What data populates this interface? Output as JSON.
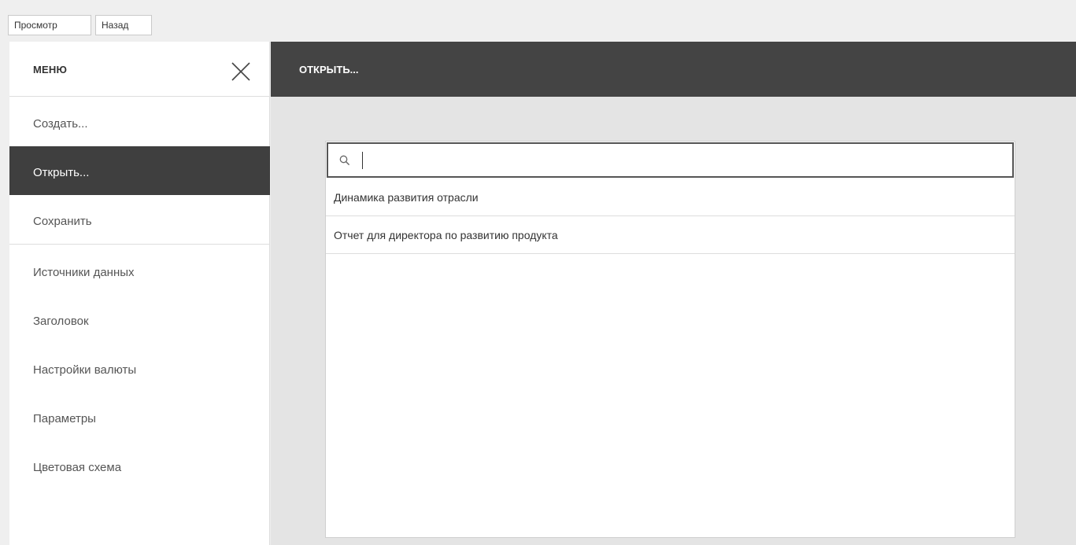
{
  "toolbar": {
    "preview_label": "Просмотр",
    "back_label": "Назад"
  },
  "sidebar": {
    "title": "МЕНЮ",
    "close_icon": "close-icon",
    "items": [
      {
        "label": "Создать...",
        "active": false
      },
      {
        "label": "Открыть...",
        "active": true
      },
      {
        "label": "Сохранить",
        "active": false
      },
      {
        "label": "Источники данных",
        "active": false
      },
      {
        "label": "Заголовок",
        "active": false
      },
      {
        "label": "Настройки валюты",
        "active": false
      },
      {
        "label": "Параметры",
        "active": false
      },
      {
        "label": "Цветовая схема",
        "active": false
      }
    ]
  },
  "main": {
    "title": "ОТКРЫТЬ...",
    "search": {
      "value": "",
      "placeholder": "",
      "icon": "search-icon"
    },
    "reports": [
      "Динамика развития отрасли",
      "Отчет для директора по развитию продукта"
    ]
  },
  "colors": {
    "accent_dark": "#3f3f3f",
    "header_dark": "#444444",
    "background": "#efefef",
    "content_bg": "#e4e4e4"
  }
}
